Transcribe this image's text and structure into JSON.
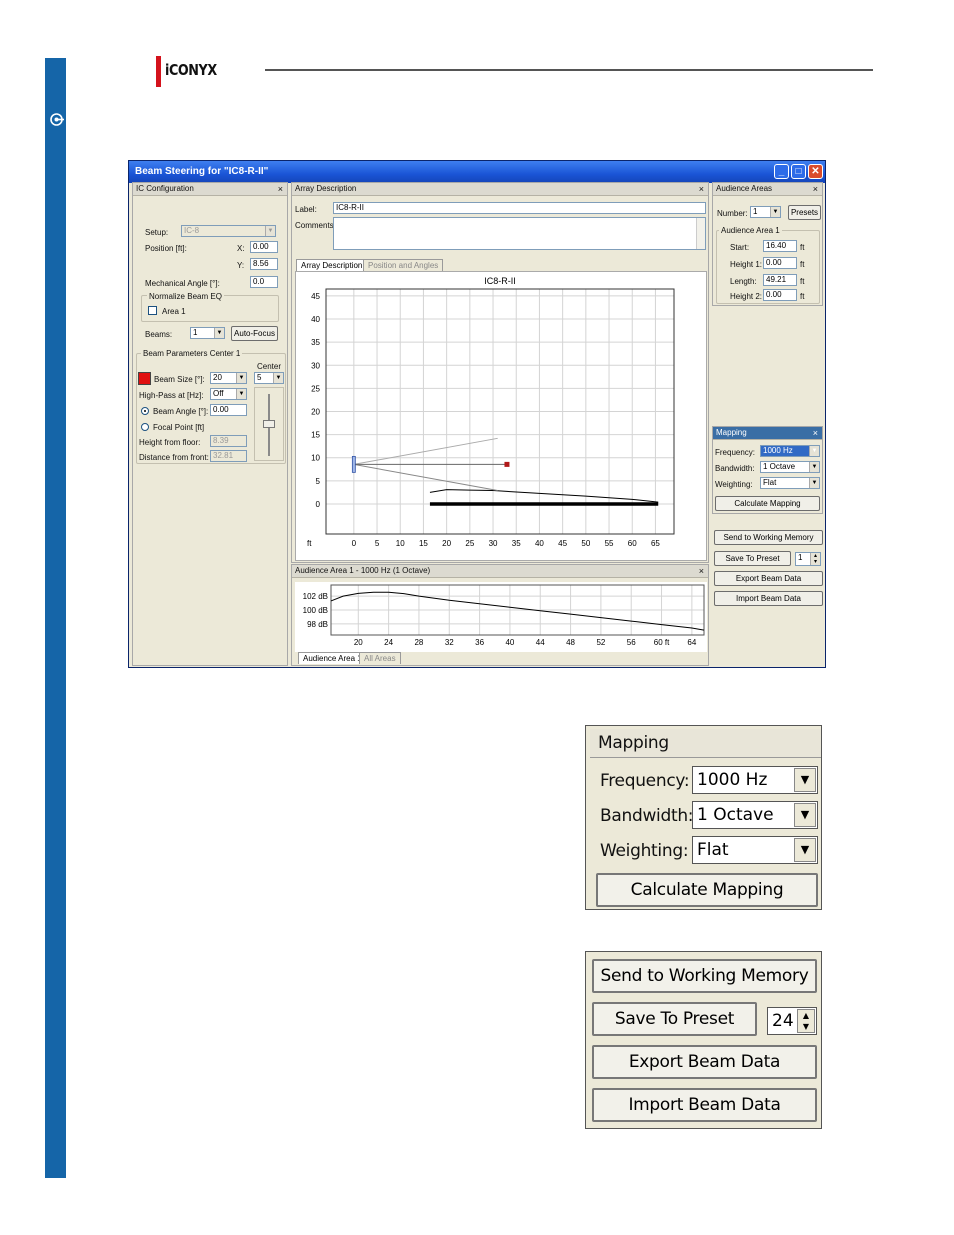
{
  "brand": {
    "logo_text": "iCONYX"
  },
  "window": {
    "title": "Beam Steering for \"IC8-R-II\"",
    "minimize": "_",
    "maximize": "□",
    "close": "✕"
  },
  "ic_config": {
    "title": "IC Configuration",
    "setup_label": "Setup:",
    "setup_value": "IC-8",
    "position_label": "Position [ft]:",
    "x_label": "X:",
    "x_value": "0.00",
    "y_label": "Y:",
    "y_value": "8.56",
    "mech_angle_label": "Mechanical Angle [°]:",
    "mech_angle_value": "0.0",
    "normalize_label": "Normalize Beam EQ",
    "area1_label": "Area 1",
    "beams_label": "Beams:",
    "beams_value": "1",
    "autofocus": "Auto-Focus",
    "beam_params_label": "Beam Parameters Center 1",
    "center_label": "Center",
    "center_value": "5",
    "beam_size_label": "Beam Size [°]:",
    "beam_size_value": "20",
    "highpass_label": "High-Pass at [Hz]:",
    "highpass_value": "Off",
    "beam_angle_label": "Beam Angle [°]:",
    "beam_angle_value": "0.00",
    "focal_point_label": "Focal Point [ft]",
    "height_floor_label": "Height from floor:",
    "height_floor_value": "8.39",
    "distance_front_label": "Distance from front:",
    "distance_front_value": "32.81",
    "beam_color": "#e01010"
  },
  "array_desc": {
    "title": "Array Description",
    "label_label": "Label:",
    "label_value": "IC8-R-II",
    "comments_label": "Comments:",
    "tabs": [
      "Array Description",
      "Position and Angles"
    ]
  },
  "chart_data": [
    {
      "type": "line",
      "title": "IC8-R-II",
      "xlabel": "ft",
      "x_ticks": [
        0,
        5,
        10,
        15,
        20,
        25,
        30,
        35,
        40,
        45,
        50,
        55,
        60,
        65
      ],
      "y_ticks": [
        0,
        5,
        10,
        15,
        20,
        25,
        30,
        35,
        40,
        45
      ],
      "xlim": [
        -6,
        69
      ],
      "ylim": [
        -6.5,
        46.5
      ],
      "grid": true,
      "series": [
        {
          "role": "audience-area",
          "x": [
            16.4,
            65.6
          ],
          "y": [
            0,
            0
          ]
        },
        {
          "role": "coverage",
          "x": [
            16.4,
            20,
            25,
            30,
            40,
            50,
            60,
            65.6
          ],
          "y": [
            2.5,
            3.1,
            3.0,
            2.9,
            2.3,
            1.7,
            1.0,
            0.4
          ]
        },
        {
          "role": "beam-upper",
          "x": [
            0,
            31
          ],
          "y": [
            8.56,
            14.2
          ]
        },
        {
          "role": "beam-lower",
          "x": [
            0,
            31
          ],
          "y": [
            8.56,
            2.9
          ]
        },
        {
          "role": "beam-axis",
          "x": [
            0,
            33
          ],
          "y": [
            8.56,
            8.56
          ]
        }
      ],
      "array_position": {
        "x": 0,
        "y": 8.56
      },
      "focal_marker": {
        "x": 33,
        "y": 8.56
      }
    },
    {
      "type": "line",
      "title": "Audience Area 1 - 1000 Hz (1 Octave)",
      "x_ticks": [
        20,
        24,
        28,
        32,
        36,
        40,
        44,
        48,
        52,
        56,
        60,
        64
      ],
      "x_tick_labels": [
        "20",
        "24",
        "28",
        "32",
        "36",
        "40",
        "44",
        "48",
        "52",
        "56",
        "60 ft",
        "64"
      ],
      "y_tick_labels": [
        "102 dB",
        "100 dB",
        "98 dB"
      ],
      "y_ticks": [
        102,
        100,
        98
      ],
      "xlim": [
        16.4,
        65.6
      ],
      "ylim": [
        96.4,
        103.6
      ],
      "grid": true,
      "series": [
        {
          "name": "Audience Area 1",
          "x": [
            16.4,
            18,
            20,
            22,
            24,
            26,
            28,
            32,
            36,
            40,
            44,
            48,
            52,
            56,
            60,
            64,
            65.6
          ],
          "y": [
            101.3,
            102.0,
            102.4,
            102.55,
            102.55,
            102.35,
            102.0,
            101.4,
            100.9,
            100.4,
            99.9,
            99.4,
            98.9,
            98.4,
            97.9,
            97.4,
            97.1
          ]
        }
      ],
      "tabs": [
        "Audience Area 1",
        "All Areas"
      ]
    }
  ],
  "audience": {
    "title": "Audience Areas",
    "number_label": "Number:",
    "number_value": "1",
    "presets": "Presets",
    "area_title": "Audience Area 1",
    "start_label": "Start:",
    "start_value": "16.40",
    "height1_label": "Height 1:",
    "height1_value": "0.00",
    "length_label": "Length:",
    "length_value": "49.21",
    "height2_label": "Height 2:",
    "height2_value": "0.00",
    "unit": "ft"
  },
  "mapping": {
    "title": "Mapping",
    "frequency_label": "Frequency:",
    "frequency_value": "1000 Hz",
    "bandwidth_label": "Bandwidth:",
    "bandwidth_value": "1 Octave",
    "weighting_label": "Weighting:",
    "weighting_value": "Flat",
    "calculate": "Calculate Mapping"
  },
  "actions": {
    "send": "Send to Working Memory",
    "save": "Save To Preset",
    "save_value_small": "1",
    "save_value_zoom": "24",
    "export": "Export Beam Data",
    "import": "Import Beam Data"
  }
}
